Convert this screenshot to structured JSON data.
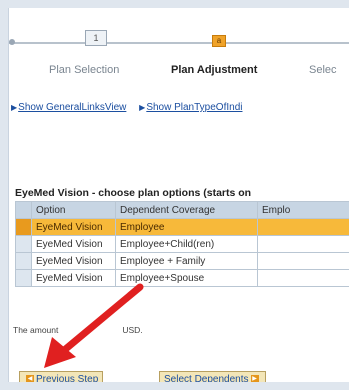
{
  "roadmap": {
    "steps": [
      {
        "label": "Plan Selection",
        "marker": "1"
      },
      {
        "label": "Plan Adjustment",
        "marker": "a"
      },
      {
        "label": "Selec"
      }
    ]
  },
  "links": {
    "general": "Show GeneralLinksView",
    "plan_type": "Show PlanTypeOfIndi"
  },
  "section_title": "EyeMed Vision - choose plan options (starts on ",
  "table": {
    "columns": [
      "Option",
      "Dependent Coverage",
      "Emplo"
    ],
    "rows": [
      {
        "option": "EyeMed Vision",
        "coverage": "Employee",
        "selected": true
      },
      {
        "option": "EyeMed Vision",
        "coverage": "Employee+Child(ren)",
        "selected": false
      },
      {
        "option": "EyeMed Vision",
        "coverage": "Employee + Family",
        "selected": false
      },
      {
        "option": "EyeMed Vision",
        "coverage": "Employee+Spouse",
        "selected": false
      }
    ]
  },
  "note": {
    "left": "The amount",
    "right": "USD."
  },
  "buttons": {
    "previous": "Previous Step",
    "next": "Select Dependents"
  },
  "colors": {
    "highlight": "#f7b93a",
    "link": "#1c4fa0",
    "annotation_arrow": "#e02020"
  }
}
